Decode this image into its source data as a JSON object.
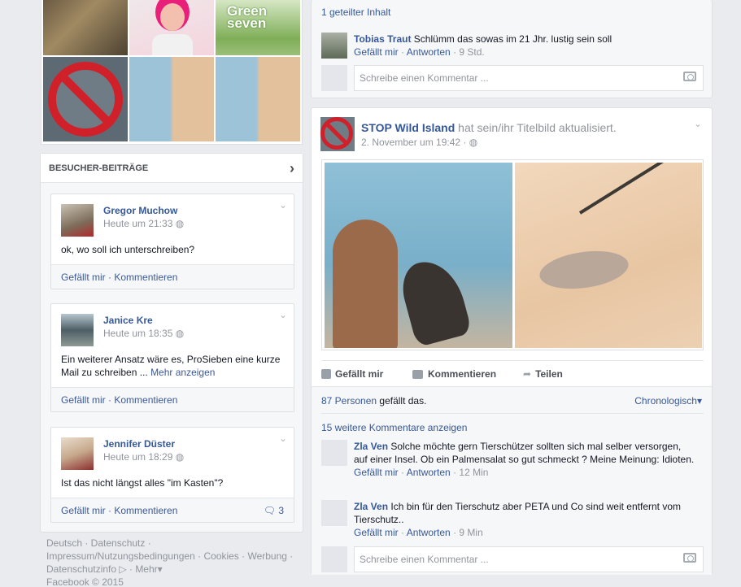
{
  "top_card": {
    "shared_link": "1 geteilter Inhalt",
    "comment": {
      "name": "Tobias Traut",
      "text": "Schlümm das sowas im 21 Jhr. lustig sein soll",
      "like": "Gefällt mir",
      "reply": "Antworten",
      "time": "9 Std."
    },
    "write_placeholder": "Schreibe einen Kommentar ..."
  },
  "photos": {
    "green_logo": "Green seven"
  },
  "visitor_posts": {
    "header": "BESUCHER-BEITRÄGE",
    "posts": [
      {
        "name": "Gregor Muchow",
        "time": "Heute um 21:33",
        "text": "ok, wo soll ich unterschreiben?",
        "more": "",
        "like": "Gefällt mir",
        "comment": "Kommentieren",
        "comment_count": ""
      },
      {
        "name": "Janice Kre",
        "time": "Heute um 18:35",
        "text": "Ein weiterer Ansatz wäre es, ProSieben eine kurze Mail zu schreiben ...",
        "more": "Mehr anzeigen",
        "like": "Gefällt mir",
        "comment": "Kommentieren",
        "comment_count": ""
      },
      {
        "name": "Jennifer Düster",
        "time": "Heute um 18:29",
        "text": "Ist das nicht längst alles \"im Kasten\"?",
        "more": "",
        "like": "Gefällt mir",
        "comment": "Kommentieren",
        "comment_count": "3"
      }
    ]
  },
  "footer": {
    "line1": "Deutsch · Datenschutz ·",
    "line2": "Impressum/Nutzungsbedingungen · Cookies · Werbung ·",
    "line3_a": "Datenschutzinfo",
    "line3_b": "· Mehr",
    "line4": "Facebook © 2015"
  },
  "post": {
    "page_name": "STOP Wild Island",
    "action_text": "hat sein/ihr Titelbild aktualisiert.",
    "time": "2. November um 19:42 ·",
    "actions": {
      "like": "Gefällt mir",
      "comment": "Kommentieren",
      "share": "Teilen"
    },
    "likes_count": "87 Personen",
    "likes_suffix": "gefällt das.",
    "order": "Chronologisch",
    "more_comments": "15 weitere Kommentare anzeigen",
    "comments": [
      {
        "name": "Zla Ven",
        "text": "Solche möchte gern Tierschützer sollten sich mal selber versorgen, auf einer Insel. Ob ein Palmensalat so gut schmeckt ? Meine Meinung: Idioten.",
        "like": "Gefällt mir",
        "reply": "Antworten",
        "time": "12 Min"
      },
      {
        "name": "Zla Ven",
        "text": "Ich bin für den Tierschutz aber PETA und Co sind weit entfernt vom Tierschutz..",
        "like": "Gefällt mir",
        "reply": "Antworten",
        "time": "9 Min"
      }
    ],
    "write_placeholder": "Schreibe einen Kommentar ..."
  }
}
